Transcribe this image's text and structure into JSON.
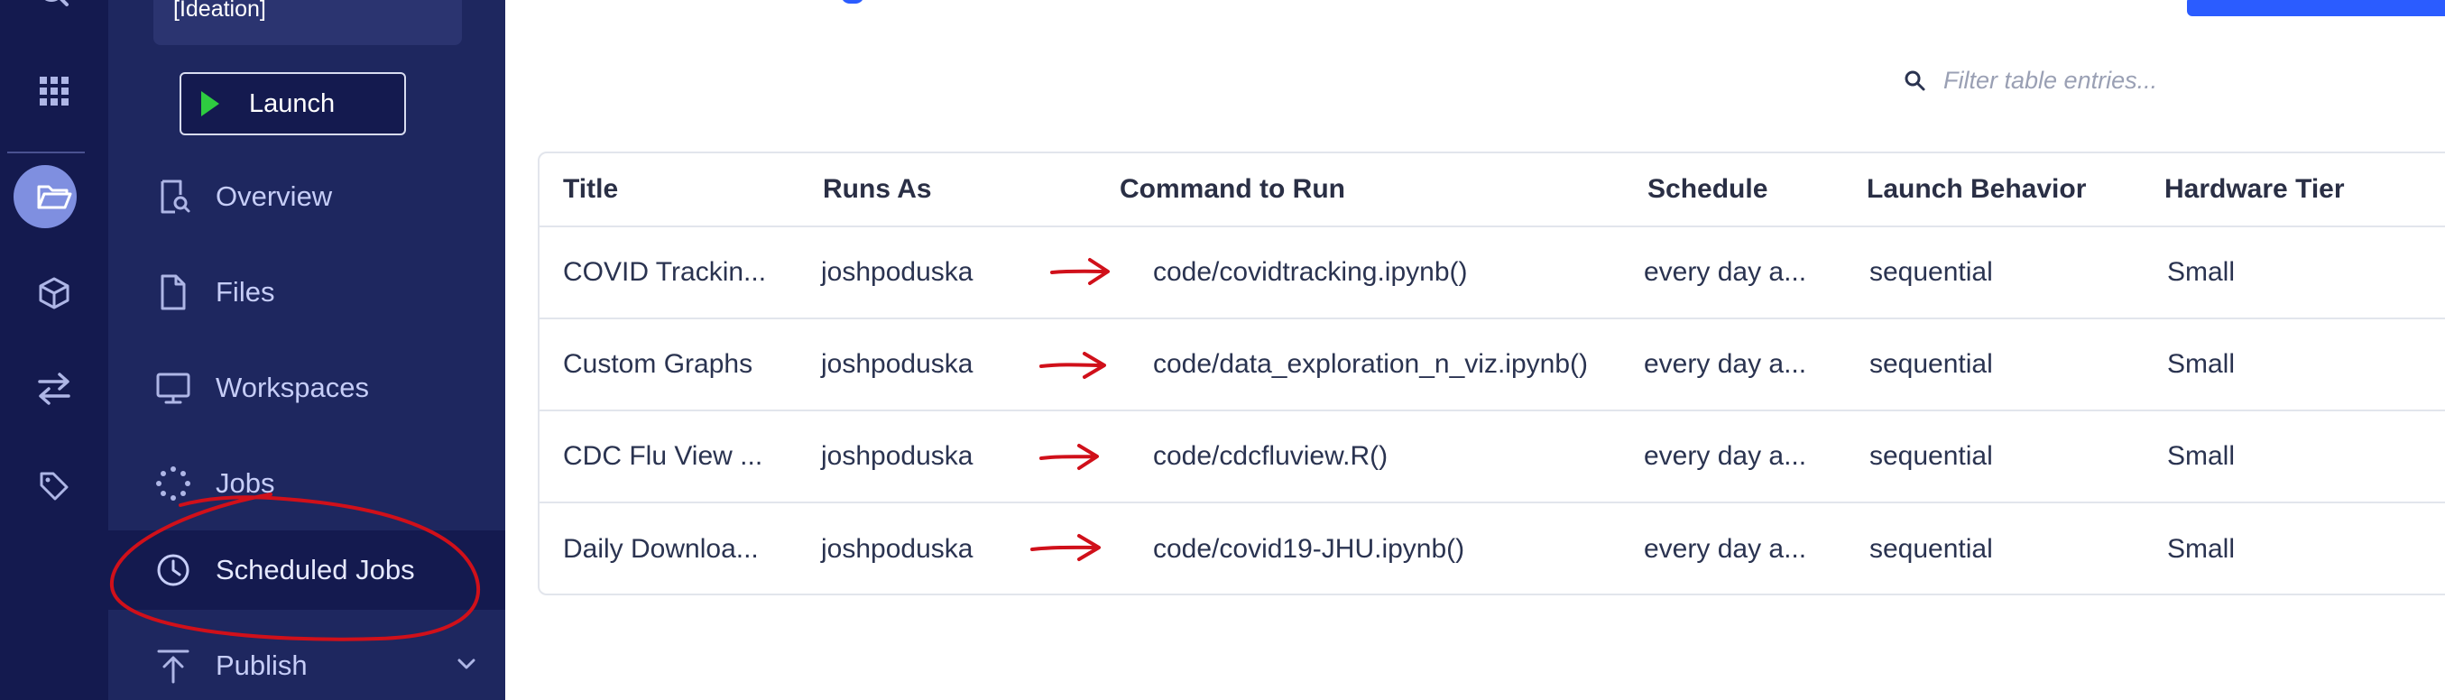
{
  "project": {
    "name": "[Ideation]"
  },
  "launch": {
    "label": "Launch"
  },
  "nav": {
    "overview": "Overview",
    "files": "Files",
    "workspaces": "Workspaces",
    "jobs": "Jobs",
    "scheduled_jobs": "Scheduled Jobs",
    "publish": "Publish"
  },
  "filter": {
    "placeholder": "Filter table entries..."
  },
  "table": {
    "columns": [
      "Title",
      "Runs As",
      "Command to Run",
      "Schedule",
      "Launch Behavior",
      "Hardware Tier"
    ],
    "rows": [
      {
        "title": "COVID Trackin...",
        "runs_as": "joshpoduska",
        "command": "code/covidtracking.ipynb()",
        "schedule": "every day a...",
        "launch_behavior": "sequential",
        "hardware_tier": "Small"
      },
      {
        "title": "Custom Graphs",
        "runs_as": "joshpoduska",
        "command": "code/data_exploration_n_viz.ipynb()",
        "schedule": "every day a...",
        "launch_behavior": "sequential",
        "hardware_tier": "Small"
      },
      {
        "title": "CDC Flu View ...",
        "runs_as": "joshpoduska",
        "command": "code/cdcfluview.R()",
        "schedule": "every day a...",
        "launch_behavior": "sequential",
        "hardware_tier": "Small"
      },
      {
        "title": "Daily Downloa...",
        "runs_as": "joshpoduska",
        "command": "code/covid19-JHU.ipynb()",
        "schedule": "every day a...",
        "launch_behavior": "sequential",
        "hardware_tier": "Small"
      }
    ]
  },
  "colors": {
    "rail_bg": "#141a4f",
    "sidebar_bg": "#1e275f",
    "accent": "#2b5cff",
    "annotation_red": "#d0101a"
  }
}
